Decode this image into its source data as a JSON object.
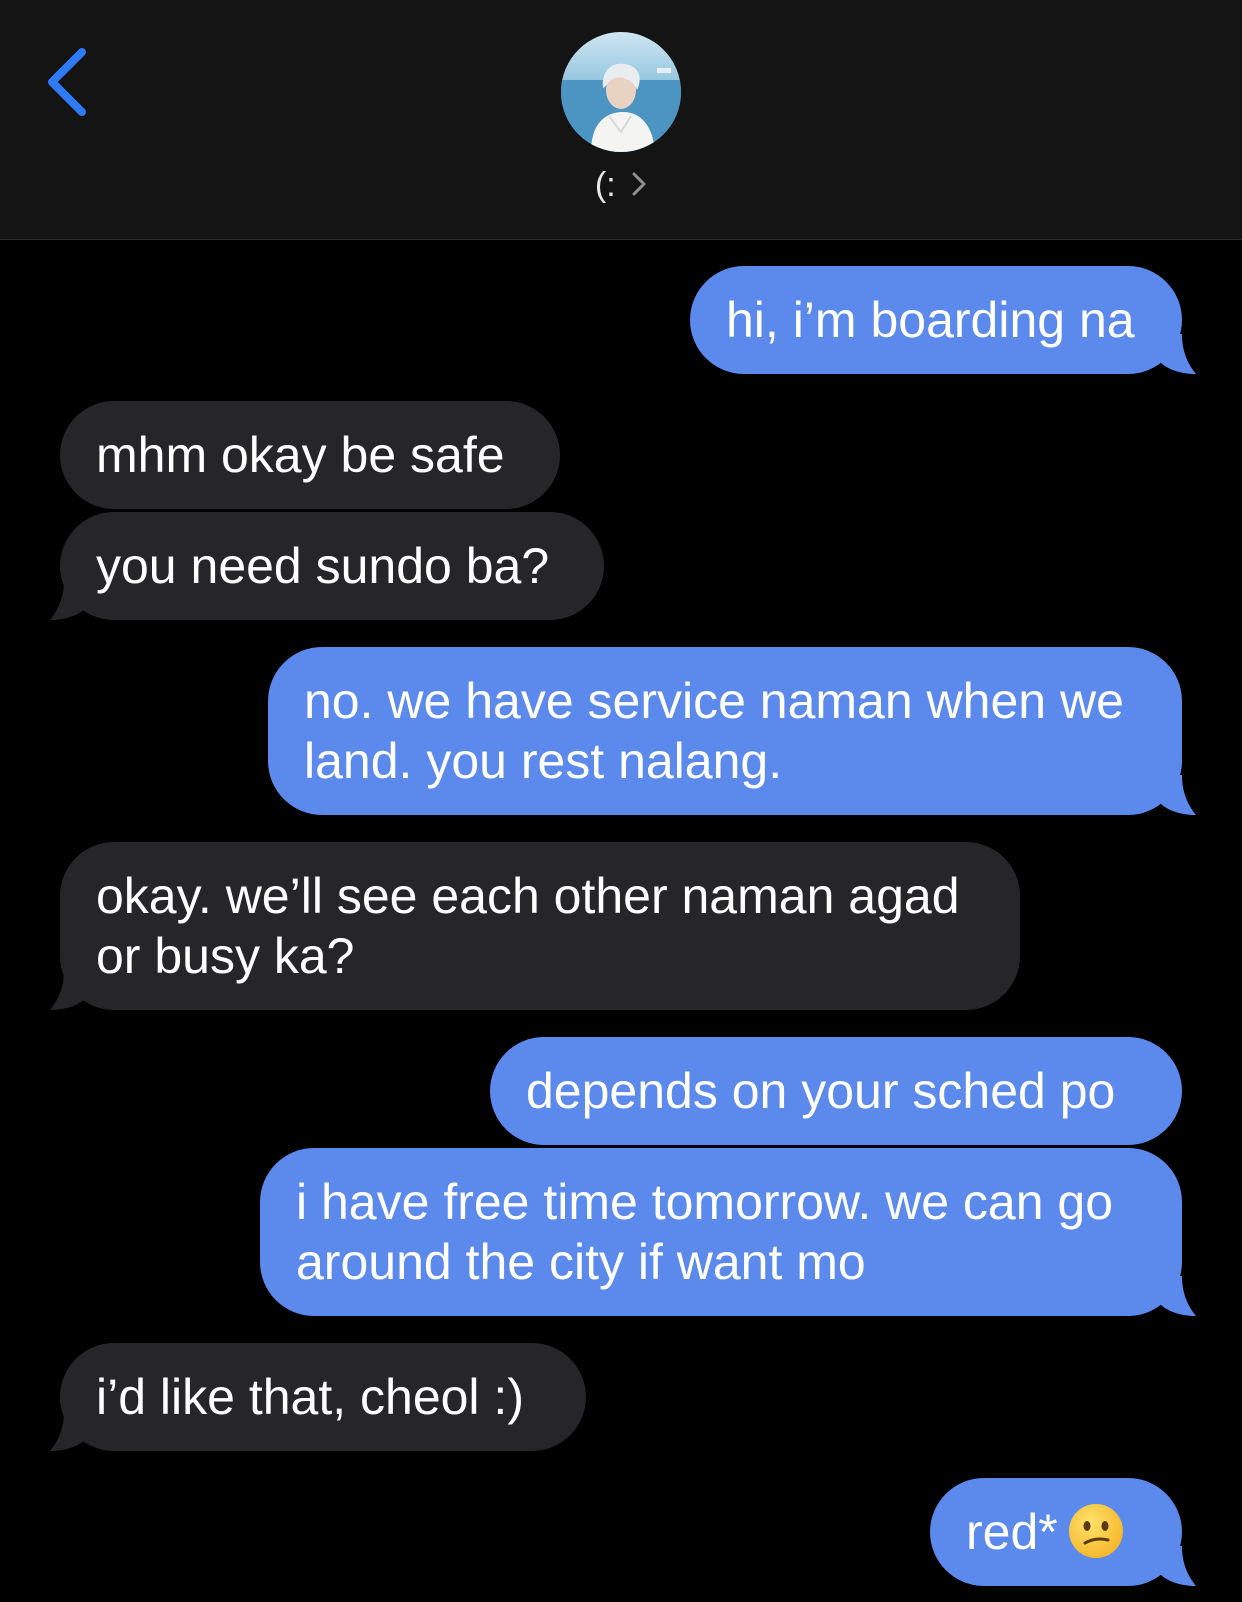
{
  "header": {
    "contact_name": "(:",
    "back_icon": "chevron-left-icon",
    "name_chevron_icon": "chevron-right-icon",
    "accent_color": "#2f7bf5"
  },
  "colors": {
    "sent_bubble": "#5b8aec",
    "received_bubble": "#262628",
    "background": "#000000"
  },
  "messages": [
    {
      "direction": "sent",
      "lines": [
        "hi, i’m boarding na"
      ]
    },
    {
      "direction": "received",
      "lines": [
        "mhm okay be safe"
      ]
    },
    {
      "direction": "received",
      "lines": [
        "you need sundo ba?"
      ]
    },
    {
      "direction": "sent",
      "lines": [
        "no. we have service naman when we",
        "land. you rest nalang."
      ]
    },
    {
      "direction": "received",
      "lines": [
        "okay. we’ll see each other naman agad",
        "or busy ka?"
      ]
    },
    {
      "direction": "sent",
      "lines": [
        "depends on your sched po"
      ]
    },
    {
      "direction": "sent",
      "lines": [
        "i have free time tomorrow. we can go",
        "around the city if want mo"
      ]
    },
    {
      "direction": "received",
      "lines": [
        "i’d like that, cheol :)"
      ]
    },
    {
      "direction": "sent",
      "lines": [
        "red*"
      ],
      "emoji": "confused-face-emoji"
    }
  ]
}
